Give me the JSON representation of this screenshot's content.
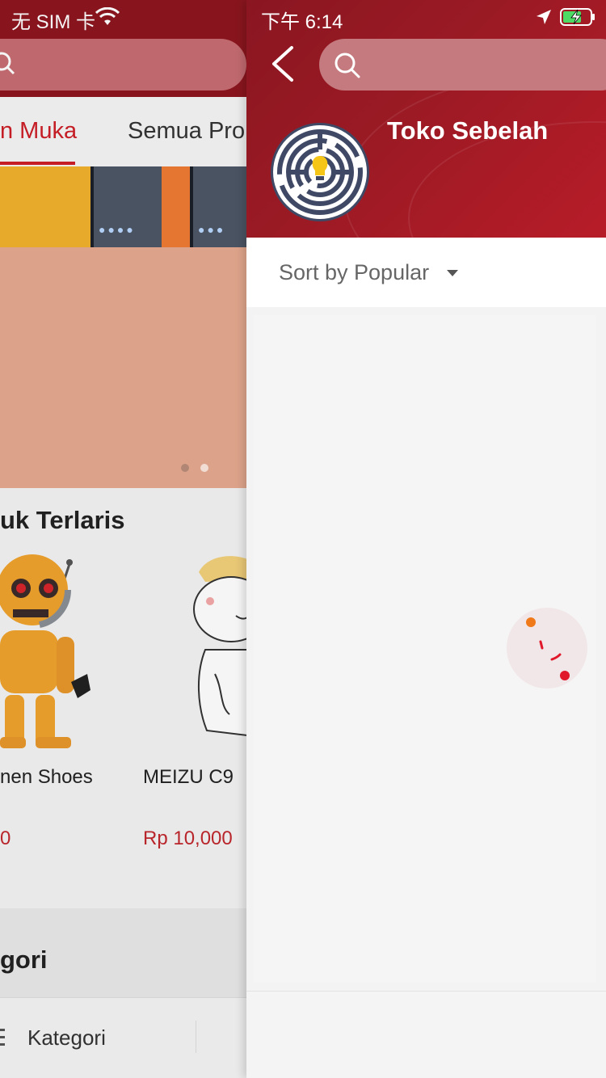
{
  "left_page": {
    "status": {
      "carrier": "无 SIM 卡"
    },
    "tabs": [
      {
        "label": "n Muka",
        "active": true
      },
      {
        "label": "Semua Pro",
        "active": false
      }
    ],
    "best_seller": {
      "title": "uk Terlaris",
      "products": [
        {
          "name": "nen Shoes",
          "price": "0",
          "icon": "robot-toy-icon"
        },
        {
          "name": "MEIZU C9",
          "price": "Rp 10,000",
          "icon": "cartoon-figure-icon"
        }
      ]
    },
    "category": {
      "title": "gori"
    },
    "tabbar": {
      "item_label": "Kategori"
    },
    "colors": {
      "brand": "#8e1620",
      "accent": "#cc1f27",
      "price": "#c0272d"
    }
  },
  "shop_page": {
    "status": {
      "time": "下午 6:14"
    },
    "search": {
      "placeholder": ""
    },
    "shop": {
      "name": "Toko Sebelah",
      "logo_icon": "maze-icon"
    },
    "sort": {
      "label": "Sort by Popular"
    },
    "colors": {
      "header": "#9b1a24",
      "background": "#f3f3f3"
    }
  }
}
